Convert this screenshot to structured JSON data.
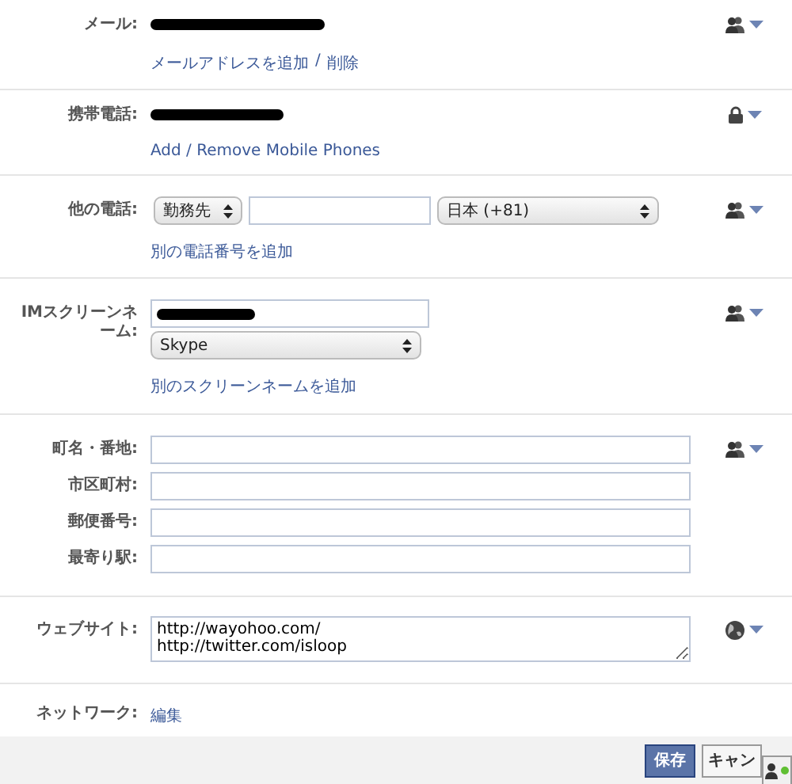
{
  "sections": [
    {
      "kind": "contact",
      "label": "メール:",
      "redacted": true,
      "privacy": {
        "kind": "friends"
      },
      "links": [
        {
          "text": "メールアドレスを追加"
        },
        {
          "text": "削除"
        }
      ],
      "separator": "/"
    },
    {
      "kind": "contact",
      "label": "携帯電話:",
      "redacted": true,
      "privacy": {
        "kind": "lock"
      },
      "links": [
        {
          "text": "Add / Remove Mobile Phones"
        }
      ]
    },
    {
      "kind": "phone",
      "label": "他の電話:",
      "privacy": {
        "kind": "friends"
      },
      "type_select": "勤務先",
      "country_select": "日本 (+81)",
      "links": [
        {
          "text": "別の電話番号を追加"
        }
      ]
    },
    {
      "kind": "im",
      "label": "IMスクリーンネーム:",
      "redacted": true,
      "privacy": {
        "kind": "friends"
      },
      "service_select": "Skype",
      "links": [
        {
          "text": "別のスクリーンネームを追加"
        }
      ]
    },
    {
      "kind": "address",
      "privacy": {
        "kind": "friends"
      },
      "fields": [
        {
          "label": "町名・番地:"
        },
        {
          "label": "市区町村:"
        },
        {
          "label": "郵便番号:"
        },
        {
          "label": "最寄り駅:"
        }
      ]
    },
    {
      "kind": "website",
      "label": "ウェブサイト:",
      "privacy": {
        "kind": "globe"
      },
      "value": "http://wayohoo.com/\nhttp://twitter.com/isloop"
    },
    {
      "kind": "network",
      "label": "ネットワーク:",
      "links": [
        {
          "text": "編集"
        }
      ]
    }
  ],
  "footer": {
    "buttons": [
      {
        "label": "保存",
        "kind": "primary"
      },
      {
        "label": "キャン",
        "kind": "secondary"
      }
    ],
    "chat_tab": {
      "online": true
    }
  }
}
